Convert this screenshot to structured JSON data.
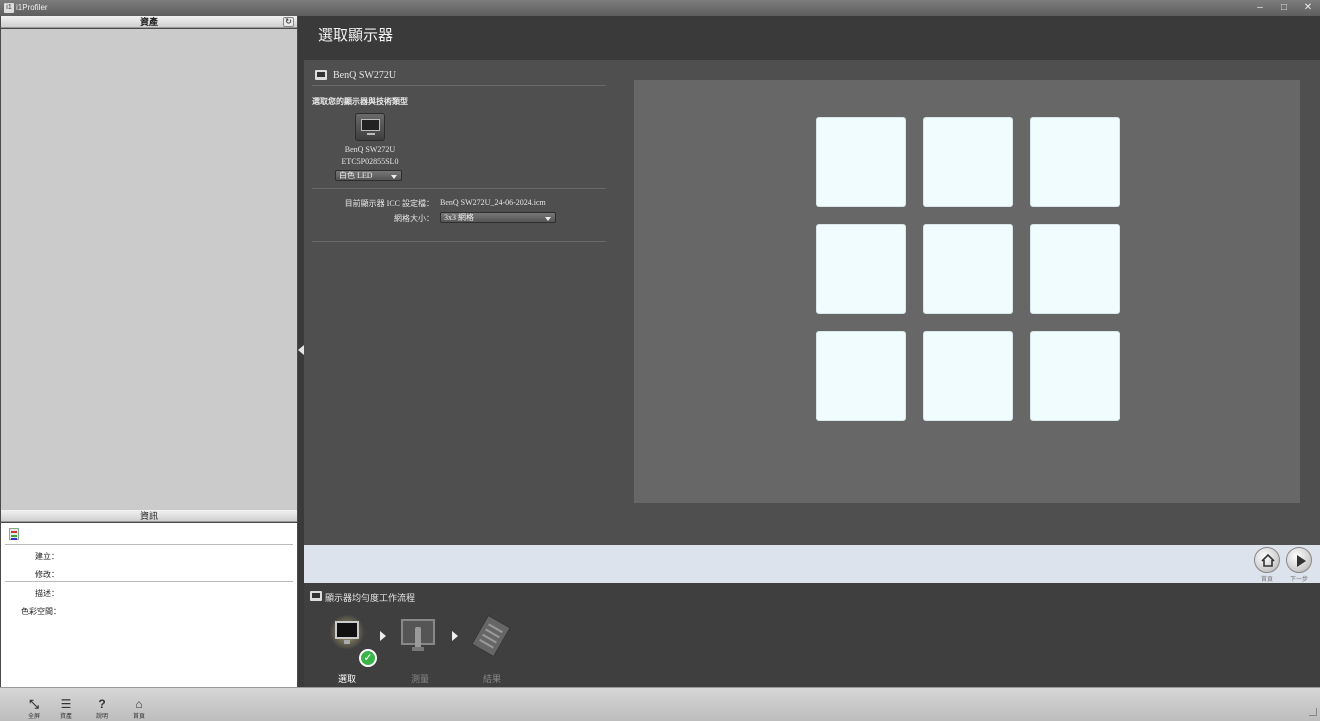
{
  "window": {
    "title": "i1Profiler"
  },
  "left_panel": {
    "assets_header": "資產",
    "info_header": "資訊",
    "info_rows": {
      "created": "建立：",
      "modified": "修改：",
      "description": "描述：",
      "color_space": "色彩空間："
    }
  },
  "main": {
    "title": "選取顯示器",
    "display_name": "BenQ SW272U",
    "select_prompt": "選取您的顯示器與技術類型",
    "monitor_model": "BenQ SW272U",
    "monitor_serial": "ETC5P02855SL0",
    "tech_type_selected": "白色 LED",
    "icc_label": "目前顯示器 ICC 設定檔：",
    "icc_value": "BenQ SW272U_24-06-2024.icm",
    "grid_label": "網格大小：",
    "grid_selected": "3x3 網格",
    "grid": {
      "rows": 3,
      "cols": 3,
      "tile_color": "#f0fcfd"
    }
  },
  "nav": {
    "home_label": "首頁",
    "next_label": "下一步"
  },
  "workflow": {
    "title": "顯示器均勻度工作流程",
    "steps": [
      {
        "label": "選取",
        "state": "completed"
      },
      {
        "label": "測量",
        "state": "inactive"
      },
      {
        "label": "結果",
        "state": "inactive"
      }
    ]
  },
  "toolbar": {
    "items": [
      {
        "label": "全屏",
        "icon": "fullscreen-icon"
      },
      {
        "label": "資產",
        "icon": "list-icon"
      },
      {
        "label": "說明",
        "icon": "help-icon"
      },
      {
        "label": "首頁",
        "icon": "home-icon"
      }
    ]
  },
  "colors": {
    "accent_check": "#3bb54a",
    "preview_bg": "#676767",
    "nav_bg": "#dde3ec"
  }
}
